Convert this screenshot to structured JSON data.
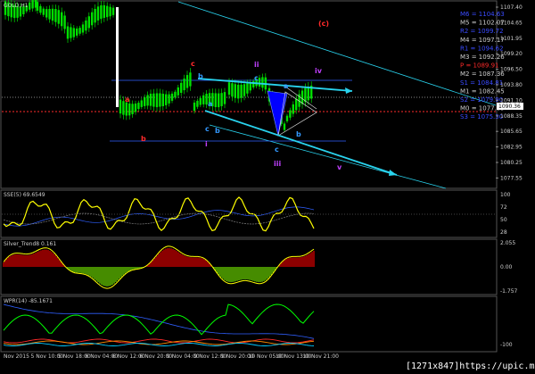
{
  "chart_data": [
    {
      "type": "candlestick",
      "panel": "price",
      "symbol_label": "GOLD,H1",
      "price_ticks": [
        "1107.40",
        "1104.65",
        "1101.95",
        "1099.20",
        "1096.50",
        "1093.80",
        "1091.10",
        "1088.35",
        "1085.65",
        "1082.95",
        "1080.25",
        "1077.55"
      ],
      "current_price": "1090.36",
      "levels": [
        {
          "label": "M6 = 1104.63",
          "color": "#3a4bff"
        },
        {
          "label": "M5 = 1102.07",
          "color": "#d0d0d0"
        },
        {
          "label": "R2 = 1099.72",
          "color": "#3a4bff"
        },
        {
          "label": "M4 = 1097.17",
          "color": "#d0d0d0"
        },
        {
          "label": "R1 = 1094.62",
          "color": "#3a4bff"
        },
        {
          "label": "M3 = 1092.26",
          "color": "#d0d0d0"
        },
        {
          "label": "P = 1089.91",
          "color": "#ff2a2a"
        },
        {
          "label": "M2 = 1087.36",
          "color": "#d0d0d0"
        },
        {
          "label": "S1 = 1084.81",
          "color": "#3a4bff"
        },
        {
          "label": "M1 = 1082.45",
          "color": "#d0d0d0"
        },
        {
          "label": "S2 = 1079.90",
          "color": "#3a4bff"
        },
        {
          "label": "M0 = 1077.65",
          "color": "#d0d0d0"
        },
        {
          "label": "S3 = 1075.30",
          "color": "#3a4bff"
        }
      ],
      "wave_labels": [
        "(c)",
        "c",
        "ii",
        "iv",
        "a",
        "b",
        "a",
        "b",
        "c",
        "b",
        "a",
        "c",
        "b",
        "i",
        "c",
        "iii",
        "v"
      ],
      "colors": {
        "bull": "#00e000",
        "bear": "#00e000",
        "trend": "#29d3ee",
        "wedge": "#0000ff",
        "pivot": "#ff2a2a"
      }
    },
    {
      "type": "line",
      "panel": "osc1",
      "title": "SSE(5) 69.6549",
      "ticks": [
        "100",
        "72",
        "50",
        "28"
      ],
      "colors": {
        "main": "#ffff00",
        "signal": "#808080",
        "blue": "#2f5fff"
      }
    },
    {
      "type": "histogram",
      "panel": "osc2",
      "title": "Silver_Trend8 0.161",
      "ticks": [
        "2.055",
        "0.00",
        "-1.757"
      ],
      "colors": {
        "up": "#7fff00",
        "down": "#ff0000",
        "line": "#ffff00"
      }
    },
    {
      "type": "line",
      "panel": "osc3",
      "title": "WPR(14) -85.1671",
      "ticks": [
        "-100"
      ],
      "colors": {
        "green": "#00ff00",
        "blue": "#2f5fff",
        "red": "#ff2a2a",
        "orange": "#ff8c00",
        "cyan": "#00c8ff"
      }
    }
  ],
  "time_labels": [
    "Nov 2015",
    "5 Nov 10:00",
    "5 Nov 18:00",
    "6 Nov 04:00",
    "6 Nov 12:00",
    "6 Nov 20:00",
    "9 Nov 04:00",
    "9 Nov 12:00",
    "9 Nov 20:00",
    "10 Nov 05:00",
    "10 Nov 13:00",
    "10 Nov 21:00"
  ],
  "watermark": "[1271x847]https://upic.me/"
}
